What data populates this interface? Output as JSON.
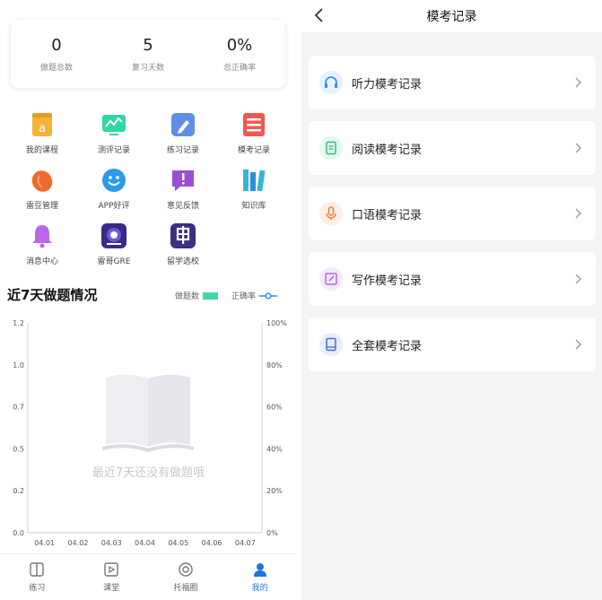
{
  "left": {
    "stats": [
      {
        "value": "0",
        "label": "做题总数"
      },
      {
        "value": "5",
        "label": "复习天数"
      },
      {
        "value": "0%",
        "label": "总正确率"
      }
    ],
    "grid": [
      {
        "label": "我的课程",
        "icon": "course-book-icon",
        "color": "#f6b13a"
      },
      {
        "label": "测评记录",
        "icon": "chart-monitor-icon",
        "color": "#2fd7a2"
      },
      {
        "label": "练习记录",
        "icon": "pencil-icon",
        "color": "#5f8de8"
      },
      {
        "label": "模考记录",
        "icon": "list-doc-icon",
        "color": "#f2574d"
      },
      {
        "label": "雷豆管理",
        "icon": "bean-icon",
        "color": "#ef6a2e"
      },
      {
        "label": "APP好评",
        "icon": "smile-icon",
        "color": "#2e9be8"
      },
      {
        "label": "意见反馈",
        "icon": "feedback-icon",
        "color": "#9a4fd6"
      },
      {
        "label": "知识库",
        "icon": "books-icon",
        "color": "#36b6d4"
      },
      {
        "label": "消息中心",
        "icon": "bell-icon",
        "color": "#b867e8"
      },
      {
        "label": "雷哥GRE",
        "icon": "gre-app-icon",
        "color": "#3a2a8c"
      },
      {
        "label": "留学选校",
        "icon": "apply-app-icon",
        "color": "#3b2f86"
      }
    ],
    "section_title": "近7天做题情况",
    "legend": {
      "bar_label": "做题数",
      "line_label": "正确率",
      "bar_color": "#3fd6a8",
      "line_color": "#2a8de6"
    },
    "empty_text": "最近7天还没有做题哦",
    "tabs": [
      {
        "label": "练习",
        "icon": "book-open-icon",
        "active": false
      },
      {
        "label": "课堂",
        "icon": "play-icon",
        "active": false
      },
      {
        "label": "托福圈",
        "icon": "circle-icon",
        "active": false
      },
      {
        "label": "我的",
        "icon": "user-icon",
        "active": true
      }
    ]
  },
  "chart_data": {
    "type": "bar",
    "categories": [
      "04.01",
      "04.02",
      "04.03",
      "04.04",
      "04.05",
      "04.06",
      "04.07"
    ],
    "series": [
      {
        "name": "做题数",
        "values": [
          0,
          0,
          0,
          0,
          0,
          0,
          0
        ]
      },
      {
        "name": "正确率",
        "values": [
          0,
          0,
          0,
          0,
          0,
          0,
          0
        ]
      }
    ],
    "y_left_ticks": [
      "1.2",
      "1.0",
      "0.7",
      "0.5",
      "0.2",
      "0.0"
    ],
    "y_right_ticks": [
      "100%",
      "80%",
      "60%",
      "40%",
      "20%",
      "0%"
    ],
    "ylim": [
      0,
      1.2
    ],
    "y2lim": [
      0,
      100
    ],
    "legend": "top-right",
    "grid": false
  },
  "right": {
    "title": "模考记录",
    "rows": [
      {
        "label": "听力模考记录",
        "icon": "headphones-icon",
        "color": "#2a8de6",
        "bg": "#e6f1fc"
      },
      {
        "label": "阅读模考记录",
        "icon": "document-icon",
        "color": "#2fbf7a",
        "bg": "#e5f7ee"
      },
      {
        "label": "口语模考记录",
        "icon": "microphone-icon",
        "color": "#ef7a3a",
        "bg": "#fdeee5"
      },
      {
        "label": "写作模考记录",
        "icon": "edit-icon",
        "color": "#b867e8",
        "bg": "#f3e9fc"
      },
      {
        "label": "全套模考记录",
        "icon": "book-icon",
        "color": "#3f6fd6",
        "bg": "#e7edfb"
      }
    ]
  }
}
